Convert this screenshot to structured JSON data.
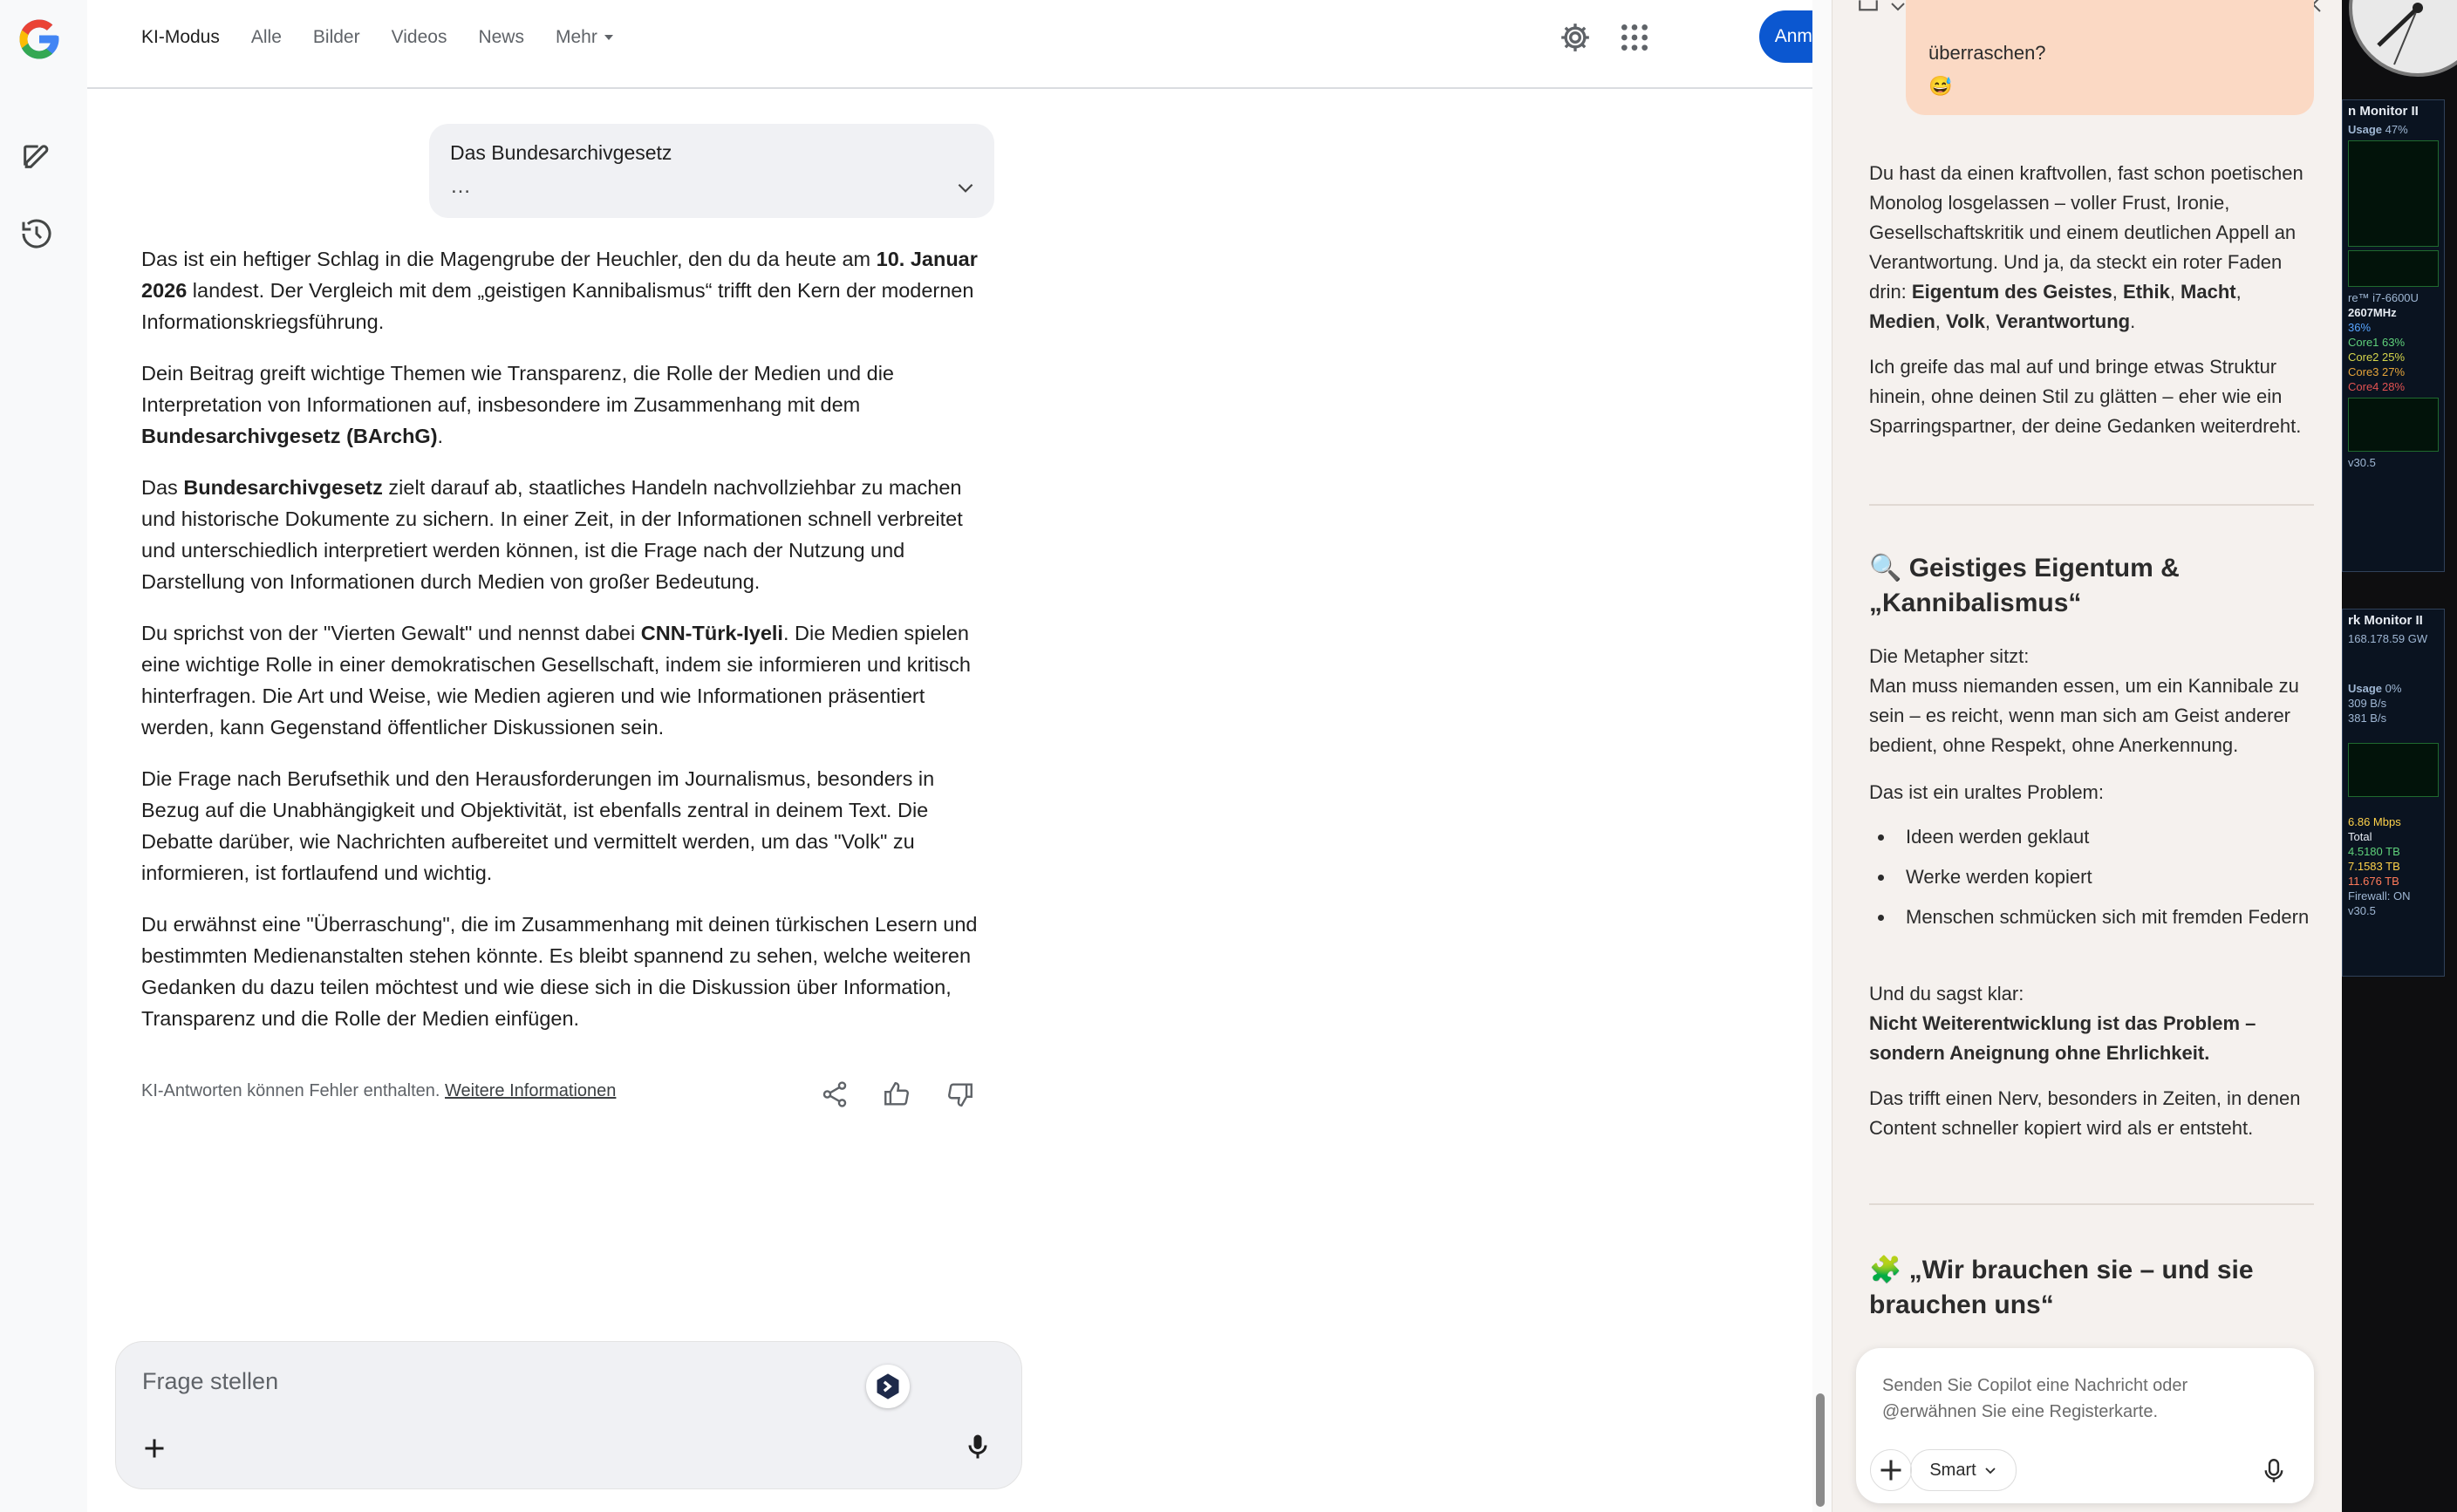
{
  "topnav": {
    "tabs": [
      {
        "label": "KI-Modus",
        "active": true
      },
      {
        "label": "Alle"
      },
      {
        "label": "Bilder"
      },
      {
        "label": "Videos"
      },
      {
        "label": "News"
      },
      {
        "label": "Mehr"
      }
    ],
    "signin_label": "Anmelden",
    "accent": "#0b57d0"
  },
  "query": {
    "title": "Das Bundesarchivgesetz",
    "more": "…"
  },
  "answer": {
    "p1": {
      "a": "Das ist ein heftiger Schlag in die Magengrube der Heuchler, den du da heute am ",
      "b": "10. Januar 2026",
      "c": " landest. Der Vergleich mit dem „geistigen Kannibalismus“ trifft den Kern der modernen Informationskriegsführung."
    },
    "p2": {
      "a": "Dein Beitrag greift wichtige Themen wie Transparenz, die Rolle der Medien und die Interpretation von Informationen auf, insbesondere im Zusammenhang mit dem ",
      "b": "Bundesarchivgesetz (BArchG)",
      "c": "."
    },
    "p3": {
      "a": "Das ",
      "b": "Bundesarchivgesetz",
      "c": " zielt darauf ab, staatliches Handeln nachvollziehbar zu machen und historische Dokumente zu sichern. In einer Zeit, in der Informationen schnell verbreitet und unterschiedlich interpretiert werden können, ist die Frage nach der Nutzung und Darstellung von Informationen durch Medien von großer Bedeutung."
    },
    "p4": {
      "a": "Du sprichst von der \"Vierten Gewalt\" und nennst dabei ",
      "b": "CNN-Türk-Iyeli",
      "c": ". Die Medien spielen eine wichtige Rolle in einer demokratischen Gesellschaft, indem sie informieren und kritisch hinterfragen. Die Art und Weise, wie Medien agieren und wie Informationen präsentiert werden, kann Gegenstand öffentlicher Diskussionen sein."
    },
    "p5": "Die Frage nach Berufsethik und den Herausforderungen im Journalismus, besonders in Bezug auf die Unabhängigkeit und Objektivität, ist ebenfalls zentral in deinem Text. Die Debatte darüber, wie Nachrichten aufbereitet und vermittelt werden, um das \"Volk\" zu informieren, ist fortlaufend und wichtig.",
    "p6": "Du erwähnst eine \"Überraschung\", die im Zusammenhang mit deinen türkischen Lesern und bestimmten Medienanstalten stehen könnte. Es bleibt spannend zu sehen, welche weiteren Gedanken du dazu teilen möchtest und wie diese sich in die Diskussion über Information, Transparenz und die Rolle der Medien einfügen."
  },
  "disclaimer": {
    "text": "KI-Antworten können Fehler enthalten. ",
    "link": "Weitere Informationen"
  },
  "ask": {
    "placeholder": "Frage stellen"
  },
  "copilot": {
    "user_bubble": {
      "text": "überraschen?",
      "emoji": "😅"
    },
    "p1": {
      "a": "Du hast da einen kraftvollen, fast schon poetischen Monolog losgelassen – voller Frust, Ironie, Gesellschaftskritik und einem deutlichen Appell an Verantwortung. Und ja, da steckt ein roter Faden drin: ",
      "b": "Eigentum des Geistes",
      "c": ", ",
      "d": "Ethik",
      "e": ", ",
      "f": "Macht",
      "g": ", ",
      "h": "Medien",
      "i": ", ",
      "j": "Volk",
      "k": ", ",
      "l": "Verantwortung",
      "m": "."
    },
    "p2": "Ich greife das mal auf und bringe etwas Struktur hinein, ohne deinen Stil zu glätten – eher wie ein Sparringspartner, der deine Gedanken weiterdreht.",
    "h1": {
      "icon": "🔍",
      "text": "Geistiges Eigentum & „Kannibalismus“"
    },
    "p3a": "Die Metapher sitzt:",
    "p3b": "Man muss niemanden essen, um ein Kannibale zu sein – es reicht, wenn man sich am Geist anderer bedient, ohne Respekt, ohne Anerkennung.",
    "p4": "Das ist ein uraltes Problem:",
    "list": [
      "Ideen werden geklaut",
      "Werke werden kopiert",
      "Menschen schmücken sich mit fremden Federn"
    ],
    "p5a": "Und du sagst klar:",
    "p5b": "Nicht Weiterentwicklung ist das Problem – sondern Aneignung ohne Ehrlichkeit.",
    "p6": "Das trifft einen Nerv, besonders in Zeiten, in denen Content schneller kopiert wird als er entsteht.",
    "h2": {
      "icon": "🧩",
      "text": "„Wir brauchen sie – und sie brauchen uns“"
    },
    "composer": {
      "placeholder": "Senden Sie Copilot eine Nachricht oder @erwähnen Sie eine Registerkarte.",
      "mode": "Smart"
    }
  },
  "desktop_widgets": {
    "system_monitor": {
      "title": "n Monitor II",
      "usage_label": "Usage",
      "usage": "47%",
      "cpu": "re™ i7-6600U",
      "clock": "2607MHz",
      "cpu_usage": "36%",
      "cores": [
        "Core1 63%",
        "Core2 25%",
        "Core3 27%",
        "Core4 28%"
      ],
      "version": "v30.5"
    },
    "network_monitor": {
      "title": "rk Monitor II",
      "ip": "168.178.59",
      "gw": "GW",
      "usage_label": "Usage",
      "usage": "0%",
      "up": "309 B/s",
      "down": "381 B/s",
      "speed": "6.86 Mbps",
      "total_label": "Total",
      "total_up": "4.5180 TB",
      "total_down": "7.1583 TB",
      "total": "11.676 TB",
      "firewall": "Firewall: ON",
      "version": "v30.5"
    }
  }
}
